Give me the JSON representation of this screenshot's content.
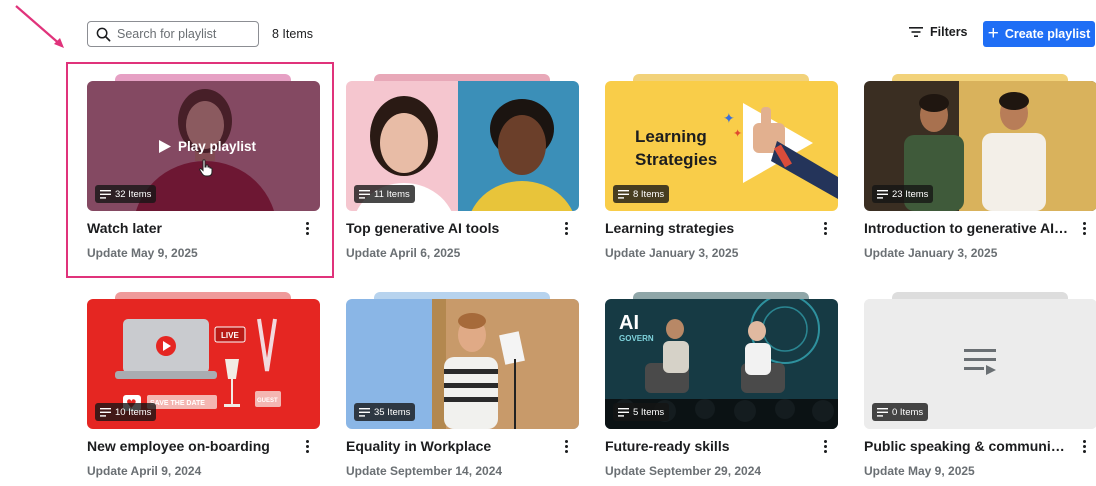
{
  "search": {
    "placeholder": "Search for playlist"
  },
  "item_count": "8 Items",
  "toolbar": {
    "filters_label": "Filters",
    "create_label": "Create playlist",
    "create_color": "#1f6ef5"
  },
  "highlight_color": "#e0337b",
  "hover_overlay": {
    "label": "Play playlist"
  },
  "image_text": {
    "learning_line1": "Learning",
    "learning_line2": "Strategies",
    "live": "LIVE",
    "save_the_date": "SAVE THE DATE",
    "guest": "GUEST",
    "ai": "AI",
    "govern": "GOVERN"
  },
  "playlists": [
    {
      "title": "Watch later",
      "date": "Update May 9, 2025",
      "items": "32 Items",
      "accent": "#e6a0c4"
    },
    {
      "title": "Top generative AI tools",
      "date": "Update April 6, 2025",
      "items": "11 Items",
      "accent": "#e8a8b8"
    },
    {
      "title": "Learning strategies",
      "date": "Update January 3, 2025",
      "items": "8 Items",
      "accent": "#f2d27a"
    },
    {
      "title": "Introduction to generative AI: U...",
      "date": "Update January 3, 2025",
      "items": "23 Items",
      "accent": "#f2d27a"
    },
    {
      "title": "New employee on-boarding",
      "date": "Update April 9, 2024",
      "items": "10 Items",
      "accent": "#ef9a9a"
    },
    {
      "title": "Equality in Workplace",
      "date": "Update September 14, 2024",
      "items": "35 Items",
      "accent": "#b7d3ee"
    },
    {
      "title": "Future-ready skills",
      "date": "Update September 29, 2024",
      "items": "5 Items",
      "accent": "#8fa6a8"
    },
    {
      "title": "Public speaking & communicatio...",
      "date": "Update May 9, 2025",
      "items": "0 Items",
      "accent": "#dddddd"
    }
  ]
}
